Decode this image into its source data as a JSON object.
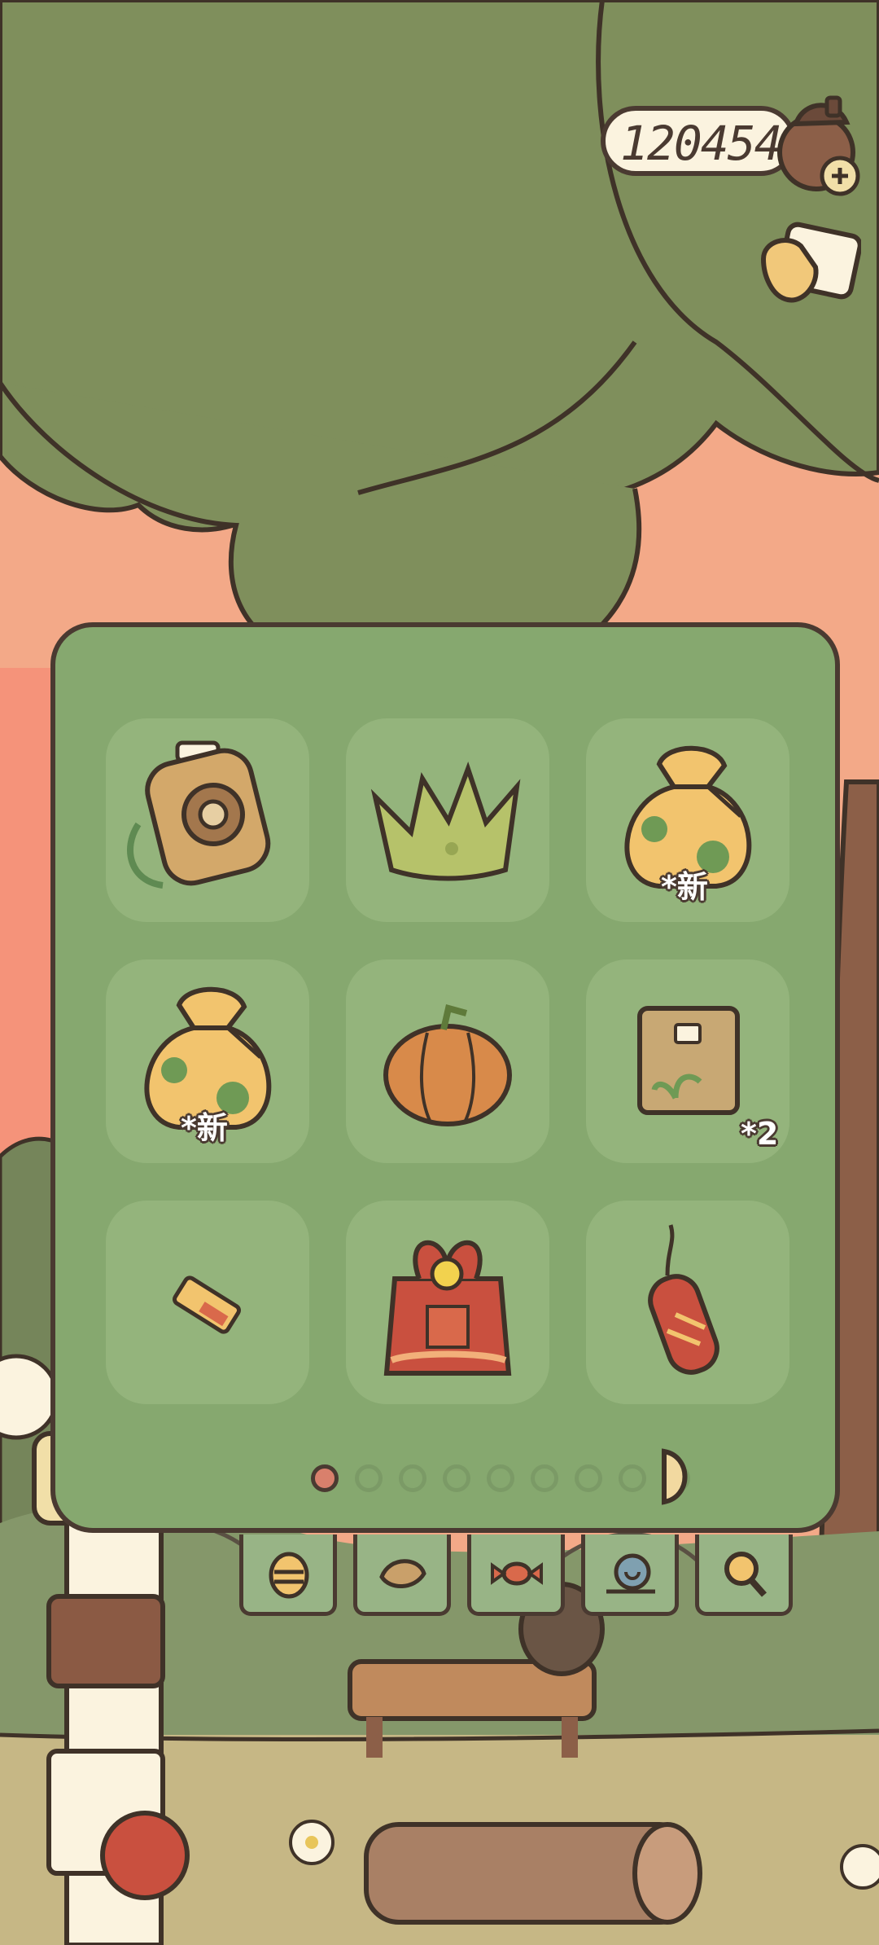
{
  "hud": {
    "currency_value": "120454",
    "currency_icon": "acorn-icon",
    "add_icon": "plus-icon",
    "action_icon": "pointing-hand-icon"
  },
  "inventory": {
    "pages_total": 9,
    "current_page": 1,
    "items": [
      {
        "name": "instant-camera",
        "icon": "camera-icon",
        "badge": ""
      },
      {
        "name": "leaf-crown",
        "icon": "crown-icon",
        "badge": ""
      },
      {
        "name": "lucky-bag",
        "icon": "lucky-bag-icon",
        "badge": "*新"
      },
      {
        "name": "lucky-bag",
        "icon": "lucky-bag-icon",
        "badge": "*新"
      },
      {
        "name": "pumpkin",
        "icon": "pumpkin-icon",
        "badge": ""
      },
      {
        "name": "seed-bag",
        "icon": "seed-bag-icon",
        "badge": "*2"
      },
      {
        "name": "ticket",
        "icon": "ticket-icon",
        "badge": ""
      },
      {
        "name": "red-gift-bag",
        "icon": "red-gift-bag-icon",
        "badge": ""
      },
      {
        "name": "firecracker",
        "icon": "firecracker-icon",
        "badge": ""
      }
    ]
  },
  "tabs": [
    {
      "name": "tab-bug",
      "icon": "bug-icon"
    },
    {
      "name": "tab-leaf",
      "icon": "leaf-icon"
    },
    {
      "name": "tab-candy",
      "icon": "candy-icon"
    },
    {
      "name": "tab-snail",
      "icon": "snail-icon"
    },
    {
      "name": "tab-search",
      "icon": "magnifier-icon"
    }
  ],
  "colors": {
    "panel": "#86a86f",
    "slot": "#94b47c",
    "outline": "#4a3a31",
    "sky": "#f3a988",
    "tree": "#7f8f5c"
  }
}
